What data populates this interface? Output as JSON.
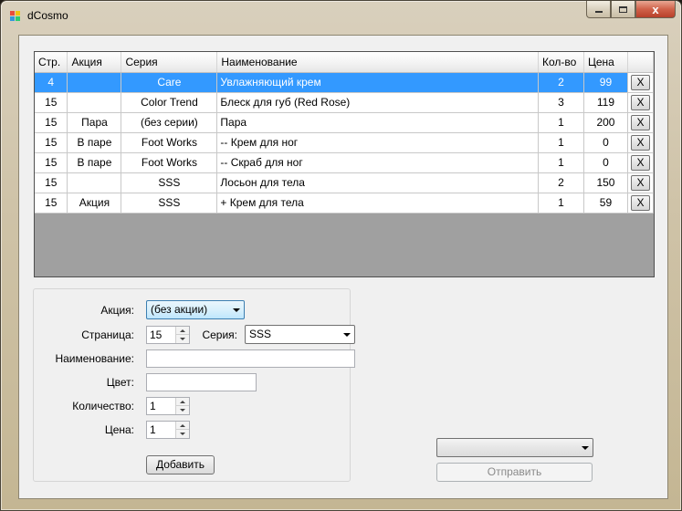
{
  "window": {
    "title": "dCosmo",
    "min_icon": "minimize-icon",
    "max_icon": "maximize-icon",
    "close_label": "x"
  },
  "grid": {
    "columns": [
      "Стр.",
      "Акция",
      "Серия",
      "Наименование",
      "Кол-во",
      "Цена",
      ""
    ],
    "rows": [
      {
        "page": "4",
        "promo": "",
        "series": "Care",
        "name": "Увлажняющий крем",
        "qty": "2",
        "price": "99",
        "del": "X",
        "selected": true
      },
      {
        "page": "15",
        "promo": "",
        "series": "Color Trend",
        "name": "Блеск для губ (Red Rose)",
        "qty": "3",
        "price": "119",
        "del": "X"
      },
      {
        "page": "15",
        "promo": "Пара",
        "series": "(без серии)",
        "name": "Пара",
        "qty": "1",
        "price": "200",
        "del": "X"
      },
      {
        "page": "15",
        "promo": "В паре",
        "series": "Foot Works",
        "name": "-- Крем для ног",
        "qty": "1",
        "price": "0",
        "del": "X"
      },
      {
        "page": "15",
        "promo": "В паре",
        "series": "Foot Works",
        "name": "-- Скраб для ног",
        "qty": "1",
        "price": "0",
        "del": "X"
      },
      {
        "page": "15",
        "promo": "",
        "series": "SSS",
        "name": "Лосьон для тела",
        "qty": "2",
        "price": "150",
        "del": "X"
      },
      {
        "page": "15",
        "promo": "Акция",
        "series": "SSS",
        "name": "+ Крем для тела",
        "qty": "1",
        "price": "59",
        "del": "X"
      }
    ]
  },
  "form": {
    "promo_label": "Акция:",
    "promo_value": "(без акции)",
    "page_label": "Страница:",
    "page_value": "15",
    "series_label": "Серия:",
    "series_value": "SSS",
    "name_label": "Наименование:",
    "name_value": "",
    "color_label": "Цвет:",
    "color_value": "",
    "qty_label": "Количество:",
    "qty_value": "1",
    "price_label": "Цена:",
    "price_value": "1",
    "add_label": "Добавить"
  },
  "send": {
    "combo_value": "",
    "send_label": "Отправить"
  }
}
